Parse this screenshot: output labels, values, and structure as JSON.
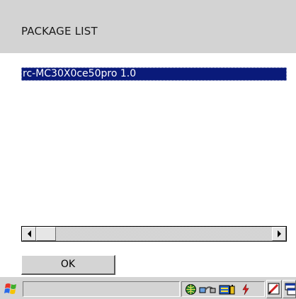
{
  "header": {
    "title": "PACKAGE LIST"
  },
  "package_list": {
    "items": [
      {
        "label": "rc-MC30X0ce50pro 1.0",
        "selected": true
      }
    ]
  },
  "buttons": {
    "ok_label": "OK"
  },
  "colors": {
    "header_bg": "#d3d3d3",
    "selection_bg": "#0a1a7a",
    "selection_text": "#ffffff",
    "button_face": "#d4d4d4"
  },
  "taskbar": {
    "start_icon": "windows-flag-icon",
    "tray_icons": [
      "network-globe-icon",
      "connection-icon",
      "battery-icon",
      "power-icon"
    ],
    "input_icon": "pen-input-icon",
    "keyboard_icon": "window-switch-icon"
  }
}
